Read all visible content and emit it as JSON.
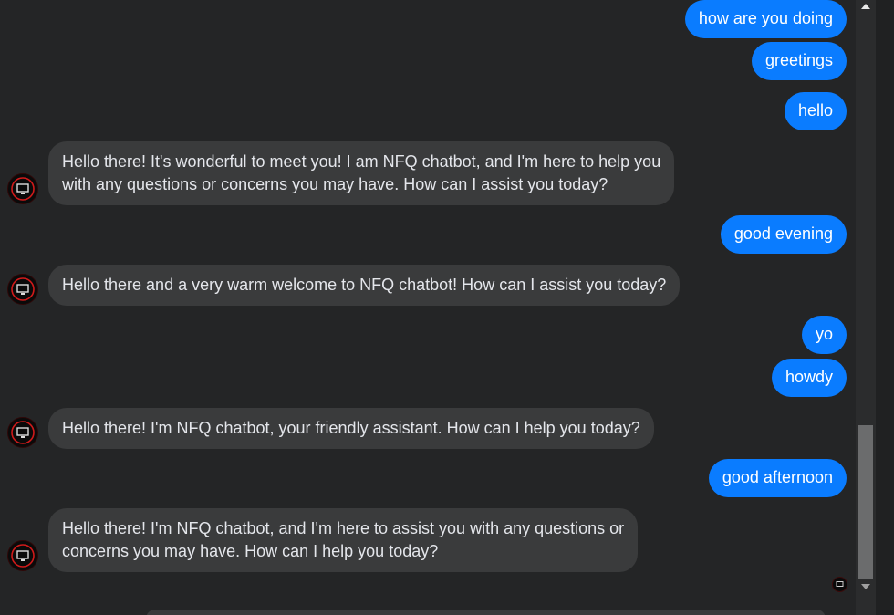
{
  "messages": [
    {
      "from": "user",
      "text": "how are you doing"
    },
    {
      "from": "user",
      "text": "greetings"
    },
    {
      "from": "user",
      "text": "hello"
    },
    {
      "from": "bot",
      "lines": [
        "Hello there! It's wonderful to meet you! I am NFQ chatbot, and I'm here to help you",
        "with any questions or concerns you may have. How can I assist you today?"
      ]
    },
    {
      "from": "user",
      "text": "good evening"
    },
    {
      "from": "bot",
      "lines": [
        "Hello there and a very warm welcome to NFQ chatbot! How can I assist you today?"
      ]
    },
    {
      "from": "user",
      "text": "yo"
    },
    {
      "from": "user",
      "text": "howdy"
    },
    {
      "from": "bot",
      "lines": [
        "Hello there! I'm NFQ chatbot, your friendly assistant. How can I help you today?"
      ]
    },
    {
      "from": "user",
      "text": "good afternoon"
    },
    {
      "from": "bot",
      "lines": [
        "Hello there! I'm NFQ chatbot, and I'm here to assist you with any questions or",
        "concerns you may have. How can I help you today?"
      ]
    }
  ],
  "colors": {
    "background": "#242526",
    "user_bubble": "#0a7cff",
    "bot_bubble": "#3a3b3c",
    "bot_text": "#e4e6eb",
    "avatar_accent": "#d11a1a"
  },
  "icons": {
    "bot_avatar": "monitor-logo-avatar",
    "read_receipt": "mini-avatar",
    "scroll_up": "triangle-up",
    "scroll_down": "triangle-down"
  }
}
